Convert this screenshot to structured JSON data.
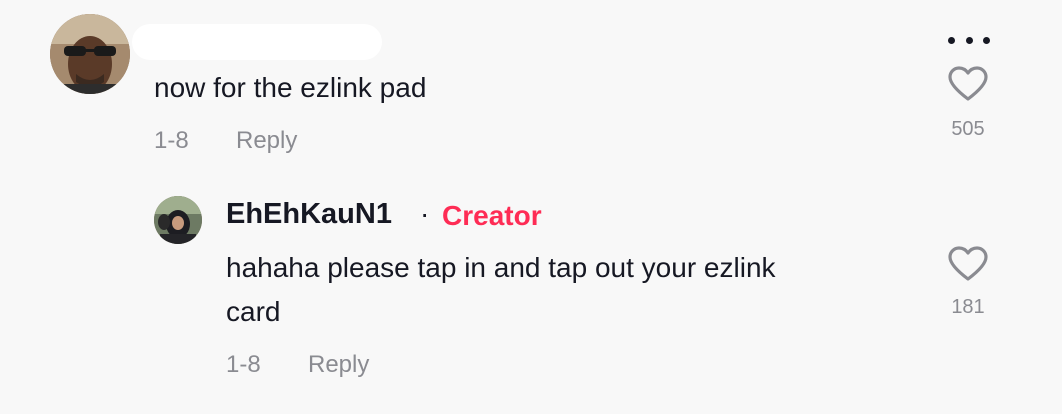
{
  "accent_color": "#fe2c55",
  "comment": {
    "text": "now for the ezlink pad",
    "date": "1-8",
    "reply_label": "Reply",
    "likes": "505"
  },
  "reply": {
    "username": "EhEhKauN1",
    "separator": "·",
    "badge": "Creator",
    "text_line1": "hahaha please tap in and tap out your ezlink",
    "text_line2": "card",
    "date": "1-8",
    "reply_label": "Reply",
    "likes": "181"
  },
  "icons": {
    "more": "more-horizontal-icon",
    "like": "heart-icon"
  }
}
